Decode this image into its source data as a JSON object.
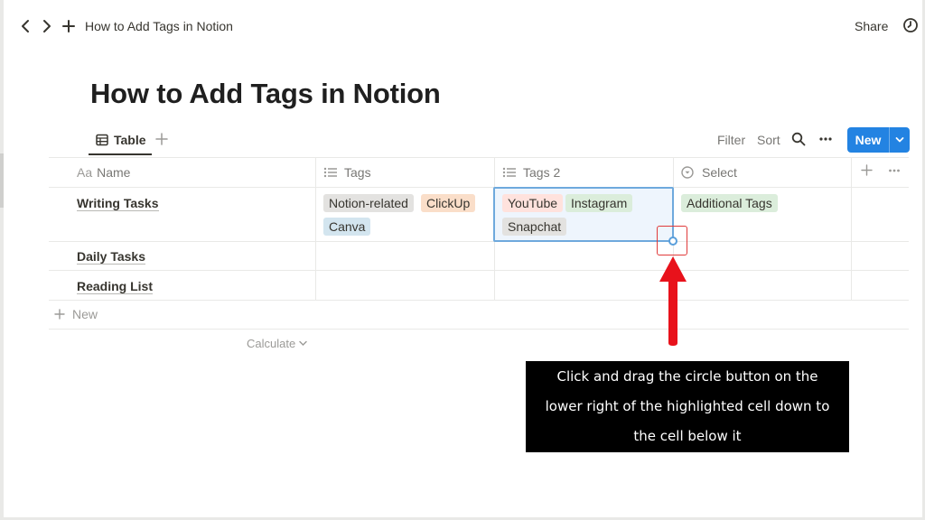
{
  "topbar": {
    "back_icon": "chevron-left-icon",
    "forward_icon": "chevron-right-icon",
    "add_icon": "plus-icon",
    "breadcrumb": "How to Add Tags in Notion",
    "share_label": "Share",
    "history_icon": "clock-icon"
  },
  "page": {
    "title": "How to Add Tags in Notion"
  },
  "view": {
    "tab_label": "Table",
    "tab_icon": "table-icon",
    "add_view_icon": "plus-icon",
    "filter_label": "Filter",
    "sort_label": "Sort",
    "search_icon": "search-icon",
    "more_icon": "ellipsis-icon",
    "new_label": "New",
    "new_dropdown_icon": "chevron-down-icon",
    "accent_color": "#2383e2"
  },
  "table": {
    "columns": [
      {
        "prefix": "Aa",
        "label": "Name"
      },
      {
        "icon": "list-icon",
        "label": "Tags"
      },
      {
        "icon": "list-icon",
        "label": "Tags 2"
      },
      {
        "icon": "chevron-circle-icon",
        "label": "Select"
      }
    ],
    "rows": [
      {
        "name": "Writing Tasks",
        "tags": [
          {
            "label": "Notion-related",
            "color": "#e3e2e0"
          },
          {
            "label": "ClickUp",
            "color": "#fadec9"
          },
          {
            "label": "Canva",
            "color": "#d3e5ef"
          }
        ],
        "tags2": [
          {
            "label": "YouTube",
            "color": "#ffe2dd"
          },
          {
            "label": "Instagram",
            "color": "#dbeddb"
          },
          {
            "label": "Snapchat",
            "color": "#e3e2e0"
          }
        ],
        "select": {
          "label": "Additional Tags",
          "color": "#dbeddb"
        }
      },
      {
        "name": "Daily Tasks"
      },
      {
        "name": "Reading List"
      }
    ],
    "new_row_label": "New",
    "calculate_label": "Calculate"
  },
  "annotation": {
    "lines": [
      "Click and drag the circle button on the",
      "lower right of the highlighted cell down to",
      "the cell below it"
    ],
    "arrow_color": "#e8121b",
    "selection_color": "#6ea9dd"
  }
}
